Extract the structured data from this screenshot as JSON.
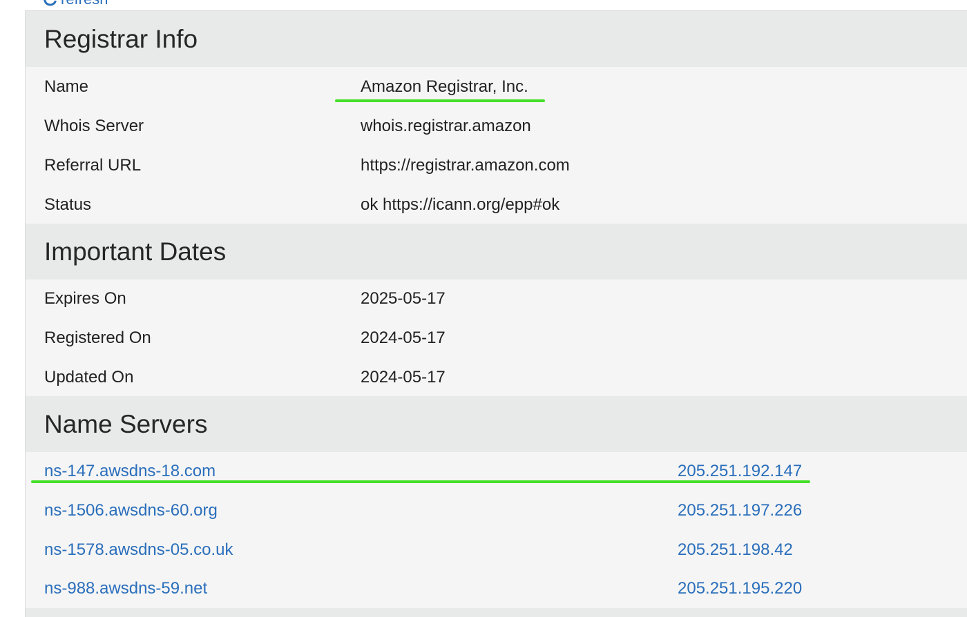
{
  "toolbar": {
    "refresh_label": "refresh"
  },
  "registrar_info": {
    "title": "Registrar Info",
    "rows": [
      {
        "label": "Name",
        "value": "Amazon Registrar, Inc."
      },
      {
        "label": "Whois Server",
        "value": "whois.registrar.amazon"
      },
      {
        "label": "Referral URL",
        "value": "https://registrar.amazon.com"
      },
      {
        "label": "Status",
        "value": "ok https://icann.org/epp#ok"
      }
    ]
  },
  "important_dates": {
    "title": "Important Dates",
    "rows": [
      {
        "label": "Expires On",
        "value": "2025-05-17"
      },
      {
        "label": "Registered On",
        "value": "2024-05-17"
      },
      {
        "label": "Updated On",
        "value": "2024-05-17"
      }
    ]
  },
  "name_servers": {
    "title": "Name Servers",
    "rows": [
      {
        "host": "ns-147.awsdns-18.com",
        "ip": "205.251.192.147"
      },
      {
        "host": "ns-1506.awsdns-60.org",
        "ip": "205.251.197.226"
      },
      {
        "host": "ns-1578.awsdns-05.co.uk",
        "ip": "205.251.198.42"
      },
      {
        "host": "ns-988.awsdns-59.net",
        "ip": "205.251.195.220"
      }
    ]
  },
  "colors": {
    "link": "#2a6ebb",
    "section_header_bg": "#e8e9e9",
    "row_bg": "#f5f5f5",
    "highlight": "#46e02a"
  },
  "icons": {
    "refresh": "refresh-icon"
  }
}
